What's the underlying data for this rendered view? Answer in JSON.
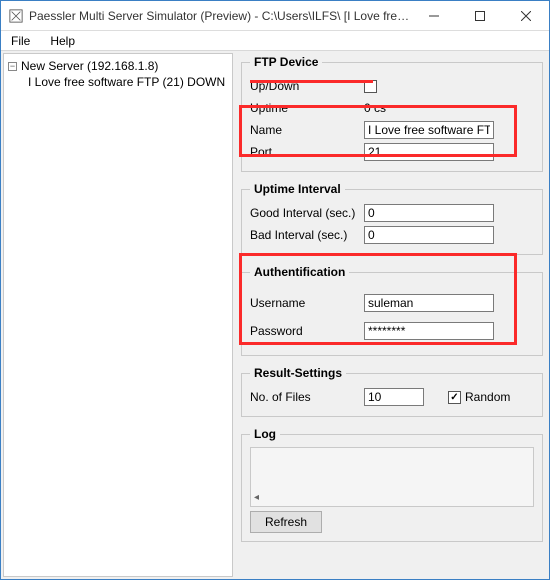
{
  "window": {
    "title": "Paessler Multi Server Simulator (Preview) - C:\\Users\\ILFS\\ [I Love free software FTP]"
  },
  "menu": {
    "file": "File",
    "help": "Help"
  },
  "tree": {
    "root_label": "New Server (192.168.1.8)",
    "child_label": "I Love free software FTP (21)  DOWN"
  },
  "ftp_device": {
    "legend": "FTP Device",
    "updown_label": "Up/Down",
    "uptime_label": "Uptime",
    "uptime_value": "0 cs",
    "name_label": "Name",
    "name_value": "I Love free software FTP",
    "port_label": "Port",
    "port_value": "21"
  },
  "uptime_interval": {
    "legend": "Uptime Interval",
    "good_label": "Good Interval (sec.)",
    "good_value": "0",
    "bad_label": "Bad Interval (sec.)",
    "bad_value": "0"
  },
  "auth": {
    "legend": "Authentification",
    "username_label": "Username",
    "username_value": "suleman",
    "password_label": "Password",
    "password_value": "********"
  },
  "results": {
    "legend": "Result-Settings",
    "nofiles_label": "No. of Files",
    "nofiles_value": "10",
    "random_label": "Random"
  },
  "log": {
    "legend": "Log",
    "refresh": "Refresh"
  }
}
